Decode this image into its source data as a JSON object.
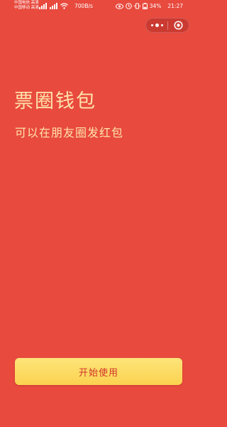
{
  "status_bar": {
    "carrier_line1": "中国电信 高清",
    "carrier_line2": "中国移动 高清",
    "net_speed": "700B/s",
    "battery_percent": "34%",
    "time": "21:27"
  },
  "header": {
    "capsule": {
      "more_icon": "more-dots-icon",
      "close_icon": "target-close-icon"
    }
  },
  "main": {
    "title": "票圈钱包",
    "subtitle": "可以在朋友圈发红包"
  },
  "footer": {
    "start_button_label": "开始使用"
  },
  "colors": {
    "background": "#e84a3e",
    "headline": "#ffe3a8",
    "button_bg": "#fbd24f",
    "button_text": "#d1332a"
  }
}
